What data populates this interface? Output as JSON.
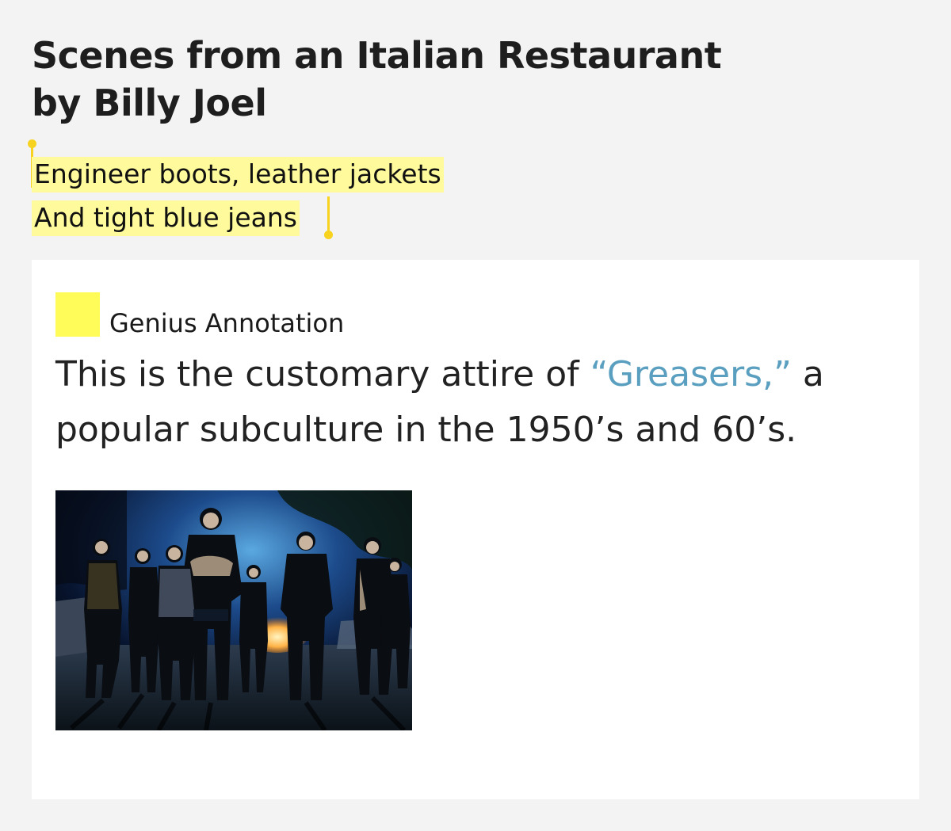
{
  "song": {
    "title_line1": "Scenes from an Italian Restaurant",
    "title_line2": "by Billy Joel"
  },
  "lyric": {
    "line1": "Engineer boots, leather jackets",
    "line2": "And tight blue jeans"
  },
  "annotation": {
    "label": "Genius Annotation",
    "body_before": "This is the customary attire of ",
    "link_text": "“Greasers,”",
    "body_after": " a popular subculture in the 1950’s and 60’s.",
    "image_icon": "group-photo-image"
  },
  "colors": {
    "background": "#f3f3f3",
    "highlight": "#fffb9c",
    "handle": "#f7d21e",
    "annotation_square": "#fffc5a",
    "link": "#5a9fbf"
  }
}
